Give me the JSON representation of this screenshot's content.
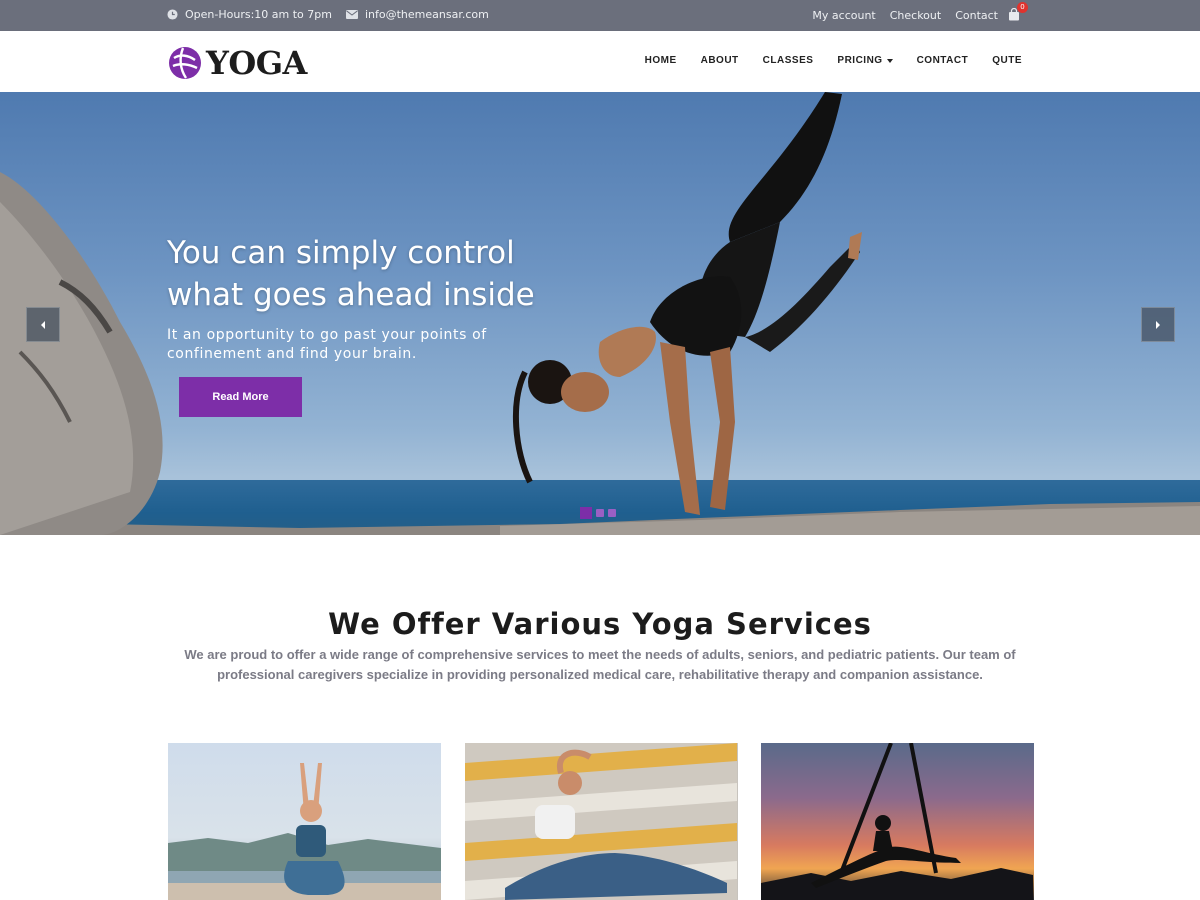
{
  "topbar": {
    "hours": "Open-Hours:10 am to 7pm",
    "email": "info@themeansar.com",
    "links": [
      "My account",
      "Checkout",
      "Contact"
    ],
    "cart_count": "0"
  },
  "header": {
    "logo_text": "YOGA",
    "nav": [
      "HOME",
      "ABOUT",
      "CLASSES",
      "PRICING",
      "CONTACT",
      "QUTE"
    ]
  },
  "hero": {
    "title_line1": "You can simply control",
    "title_line2": "what goes ahead inside",
    "subtitle_line1": "It an opportunity to go past your points of",
    "subtitle_line2": "confinement and find your brain.",
    "button_label": "Read More",
    "slides_total": 3,
    "active_slide": 1
  },
  "services": {
    "title": "We Offer Various Yoga Services",
    "description_line1": "We are proud to offer a wide range of comprehensive services to meet the needs of adults, seniors, and pediatric patients. Our team of",
    "description_line2": "professional caregivers specialize in providing personalized medical care, rehabilitative therapy and companion assistance."
  },
  "colors": {
    "topbar_bg": "#6b6f7c",
    "accent_purple": "#7d2ea8",
    "cart_badge": "#e0332e"
  },
  "icons": [
    "clock-icon",
    "envelope-icon",
    "shopping-bag-icon",
    "logo-icon",
    "caret-down-icon",
    "chevron-left-icon",
    "chevron-right-icon"
  ]
}
